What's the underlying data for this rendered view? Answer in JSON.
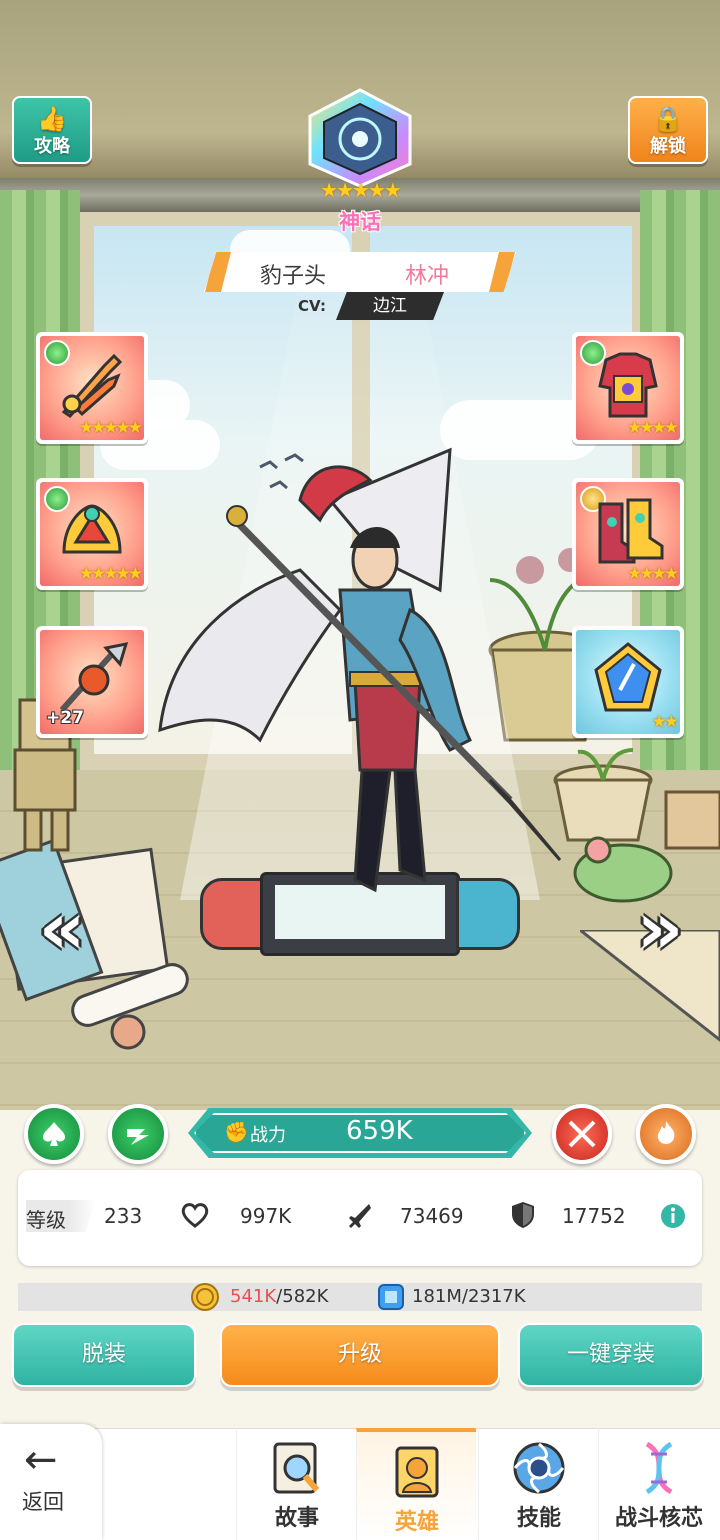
{
  "top": {
    "guide_label": "攻略",
    "unlock_label": "解锁",
    "rarity": "神话",
    "star_count": 5
  },
  "hero": {
    "title": "豹子头",
    "name": "林冲",
    "cv_label": "CV:",
    "cv_name": "边江"
  },
  "equipment": {
    "left": [
      {
        "icon": "sword-icon",
        "stars": "★★★★★"
      },
      {
        "icon": "helmet-icon",
        "stars": "★★★★★"
      },
      {
        "icon": "spear-icon",
        "plus": "+27"
      }
    ],
    "right": [
      {
        "icon": "armor-icon",
        "stars": "★★★★"
      },
      {
        "icon": "boots-icon",
        "stars": "★★★★"
      },
      {
        "icon": "crystal-icon",
        "stars": "★★"
      }
    ]
  },
  "power": {
    "label": "战力",
    "value": "659K"
  },
  "stats": {
    "level_label": "等级",
    "level": "233",
    "hp": "997K",
    "attack": "73469",
    "defense": "17752"
  },
  "resources": {
    "gold_current": "541K",
    "gold_required": "/582K",
    "exp": "181M/2317K"
  },
  "actions": {
    "unequip": "脱装",
    "upgrade": "升级",
    "equip_all": "一键穿装"
  },
  "nav": {
    "back": "返回",
    "tabs": [
      {
        "label": "故事",
        "icon": "story-icon"
      },
      {
        "label": "英雄",
        "icon": "hero-icon",
        "active": true
      },
      {
        "label": "技能",
        "icon": "skill-icon"
      },
      {
        "label": "战斗核芯",
        "icon": "battle-core-icon"
      }
    ]
  },
  "colors": {
    "teal": "#35b7a8",
    "orange": "#f6a33a",
    "pink": "#f07b9a",
    "low_resource_red": "#e84f4f"
  }
}
